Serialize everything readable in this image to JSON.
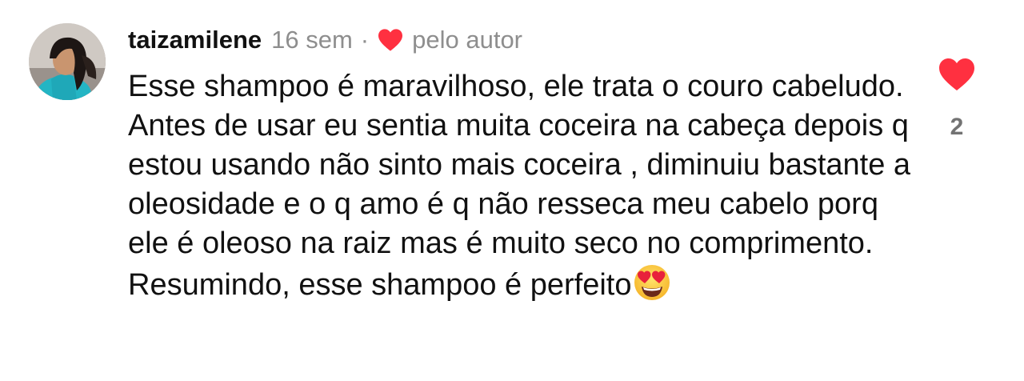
{
  "comment": {
    "username": "taizamilene",
    "time_ago": "16 sem",
    "separator": "·",
    "author_liked_label": "pelo autor",
    "text": "Esse shampoo é maravilhoso, ele trata o couro cabeludo. Antes de usar eu sentia muita coceira na cabeça depois q estou usando não sinto mais coceira , diminuiu bastante a oleosidade e o q amo é q não resseca meu cabelo porq ele é oleoso na raiz mas é muito seco no comprimento. Resumindo, esse shampoo é perfeito",
    "emoji": "heart-eyes-emoji",
    "like_count": "2",
    "liked": true
  },
  "icons": {
    "author_heart": "heart-icon",
    "like": "heart-icon"
  },
  "colors": {
    "heart": "#ff3040",
    "secondary_text": "#8e8e8e",
    "count_text": "#737373"
  }
}
